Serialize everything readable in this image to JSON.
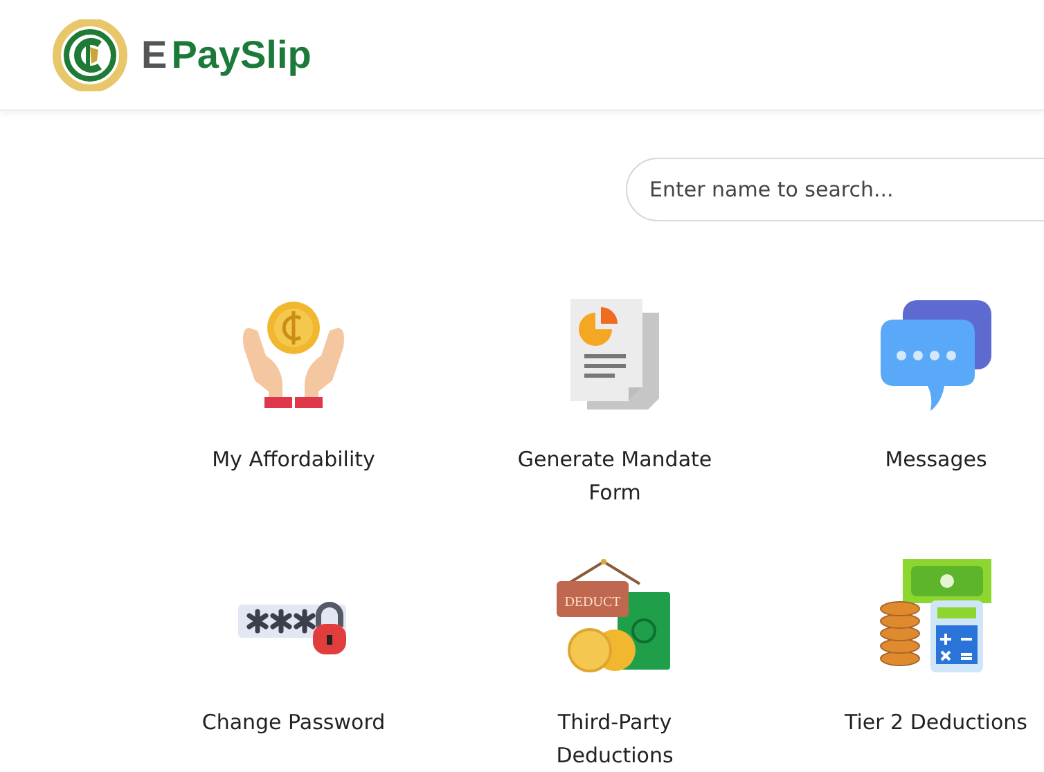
{
  "header": {
    "brand_prefix": "E",
    "brand_name": "PaySlip"
  },
  "search": {
    "placeholder": "Enter name to search..."
  },
  "tiles": [
    {
      "kind": "affordability",
      "label": "My Affordability"
    },
    {
      "kind": "mandate",
      "label": "Generate Mandate Form"
    },
    {
      "kind": "messages",
      "label": "Messages"
    },
    {
      "kind": "password",
      "label": "Change Password"
    },
    {
      "kind": "deductions",
      "label": "Third-Party Deductions",
      "sign": "DEDUCT"
    },
    {
      "kind": "tier2",
      "label": "Tier 2 Deductions"
    }
  ]
}
